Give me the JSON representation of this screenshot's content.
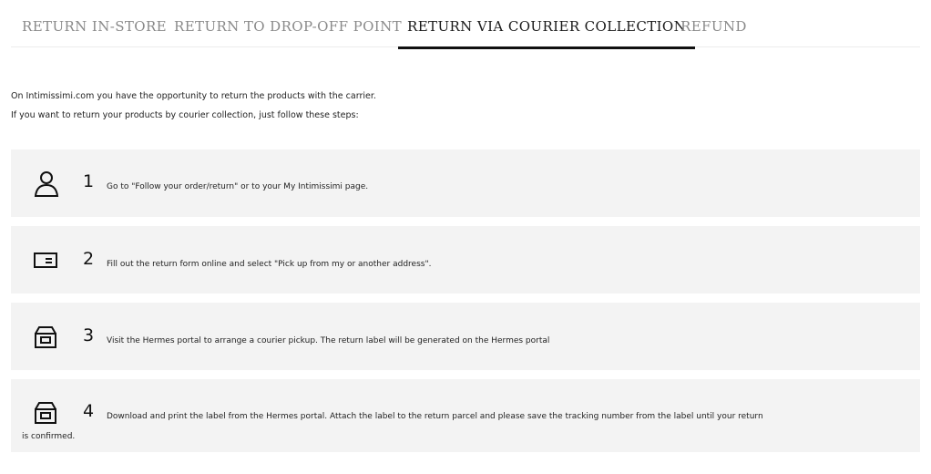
{
  "tabs": [
    {
      "label": "RETURN IN-STORE",
      "active": false
    },
    {
      "label": "RETURN TO DROP-OFF POINT",
      "active": false
    },
    {
      "label": "RETURN VIA COURIER COLLECTION",
      "active": true
    },
    {
      "label": "REFUND",
      "active": false
    }
  ],
  "intro": {
    "line1": "On Intimissimi.com you have the opportunity to return the products with the carrier.",
    "line2": "If you want to return your products by courier collection, just follow these steps:"
  },
  "steps": [
    {
      "number": "1",
      "icon": "user-icon",
      "text": "Go to \"Follow your order/return\" or to your My Intimissimi page."
    },
    {
      "number": "2",
      "icon": "form-icon",
      "text": "Fill out the return form online and select \"Pick up from my or another address\"."
    },
    {
      "number": "3",
      "icon": "box-icon",
      "text": "Visit the Hermes portal to arrange a courier pickup. The return label will be generated on the Hermes portal"
    },
    {
      "number": "4",
      "icon": "box-icon",
      "text": "Download and print the label from the Hermes portal. Attach the label to the return parcel and please save the tracking number from the label until your return",
      "text_cont": "is confirmed."
    }
  ],
  "colors": {
    "active_tab": "#1a1a1a",
    "inactive_tab": "#8a8a8a",
    "step_background": "#f3f3f3",
    "underline": "#111111"
  }
}
